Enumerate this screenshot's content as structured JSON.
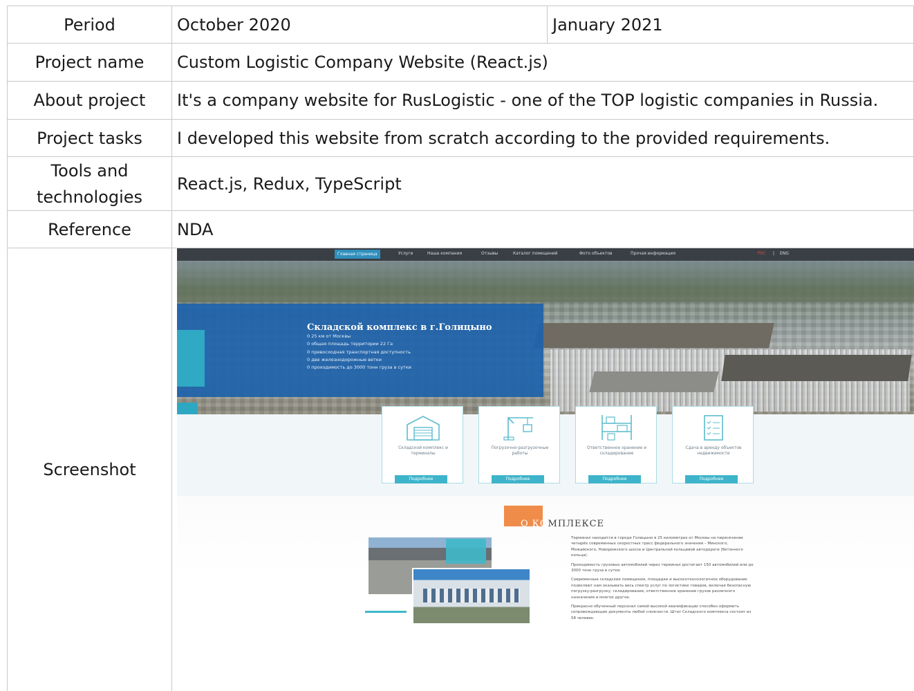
{
  "rows": {
    "period": {
      "label": "Period",
      "start": "October 2020",
      "end": "January 2021"
    },
    "project_name": {
      "label": "Project name",
      "value": "Custom Logistic Company Website (React.js)"
    },
    "about": {
      "label": "About project",
      "value": "It's a company website for RusLogistic - one of the TOP logistic companies in Russia."
    },
    "tasks": {
      "label": "Project tasks",
      "value": "I developed this website from scratch according to the provided requirements."
    },
    "tools": {
      "label_line1": "Tools and",
      "label_line2": "technologies",
      "value": "React.js, Redux, TypeScript"
    },
    "reference": {
      "label": "Reference",
      "value": "NDA"
    },
    "screenshot": {
      "label": "Screenshot"
    }
  },
  "site": {
    "nav": [
      "Главная страница",
      "Услуги",
      "Наша компания",
      "Отзывы",
      "Каталог помещений",
      "Фото объектов",
      "Прочая информация"
    ],
    "lang": [
      "РУС",
      "|",
      "ENG"
    ],
    "hero_title": "Складской комплекс в г.Голицыно",
    "hero_items": [
      "0 25 км от Москвы",
      "0 общая площадь территории 22 Га",
      "0 превосходная транспортная доступность",
      "0 две железнодорожные ветки",
      "0 проходимость до 3000 тонн груза в сутки"
    ],
    "cards": [
      {
        "text": "Складской комплекс и терминалы",
        "button": "Подробнее",
        "icon": "warehouse-icon"
      },
      {
        "text": "Погрузочно-разгрузочные работы",
        "button": "Подробнее",
        "icon": "crane-icon"
      },
      {
        "text": "Ответственное хранение и складирование",
        "button": "Подробнее",
        "icon": "shelving-icon"
      },
      {
        "text": "Сдача в аренду объектов недвижимости",
        "button": "Подробнее",
        "icon": "checklist-icon"
      }
    ],
    "about_title_highlight": "О КО",
    "about_title_rest": "МПЛЕКСЕ",
    "about_paragraphs": [
      "Терминал находится в городе Голицыно в 25 километрах от Москвы на пересечении четырёх современных скоростных трасс федерального значения – Минского, Можайского, Новорижского шоссе и Центральной кольцевой автодороги (бетонного кольца).",
      "Проходимость грузовых автомобилей через терминал достигает 150 автомобилей или до 3000 тонн груза в сутки.",
      "Современные складские помещения, площадки и высокотехнологичное оборудование позволяют нам оказывать весь спектр услуг по логистике товаров, включая безопасную погрузку-разгрузку, складирование, ответственное хранение грузов различного назначения и многое другое.",
      "Прекрасно обученный персонал самой высокой квалификации способен оформить сопровождающие документы любой сложности. Штат Складского комплекса состоит из 58 человек."
    ]
  }
}
